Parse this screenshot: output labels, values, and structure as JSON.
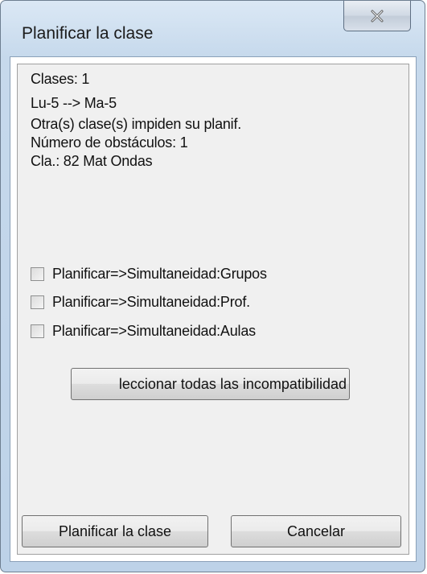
{
  "window": {
    "title": "Planificar la clase",
    "close_icon": "close-x-icon"
  },
  "info": {
    "lines": [
      "Clases: 1",
      "Lu-5 --> Ma-5",
      "Otra(s) clase(s) impiden su planif.",
      "Número de obstáculos: 1",
      "Cla.: 82 Mat Ondas"
    ]
  },
  "options": [
    {
      "label": "Planificar=>Simultaneidad:Grupos",
      "checked": false
    },
    {
      "label": "Planificar=>Simultaneidad:Prof.",
      "checked": false
    },
    {
      "label": "Planificar=>Simultaneidad:Aulas",
      "checked": false
    }
  ],
  "buttons": {
    "select_all": "leccionar todas las incompatibilidad",
    "plan": "Planificar la clase",
    "cancel": "Cancelar"
  }
}
